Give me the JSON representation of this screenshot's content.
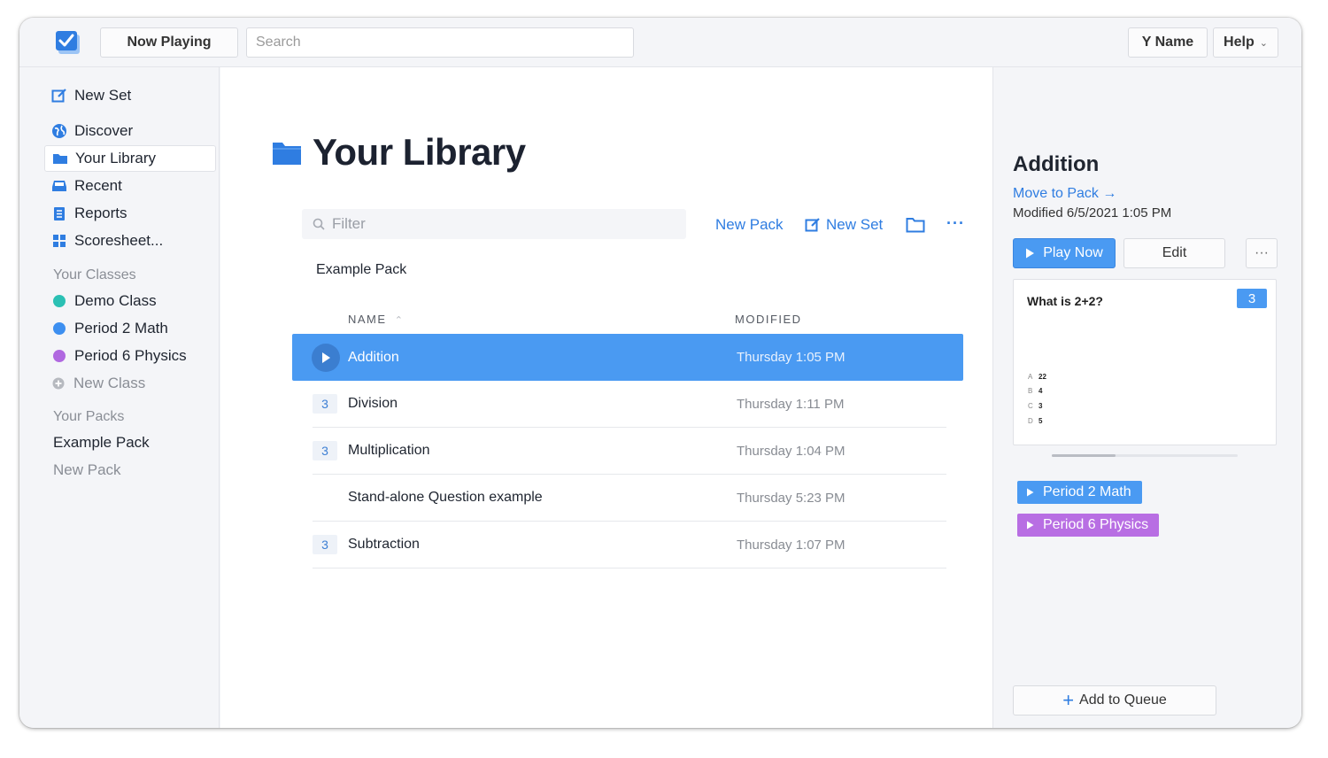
{
  "topbar": {
    "now_playing": "Now Playing",
    "search_placeholder": "Search",
    "user_name": "Y Name",
    "help": "Help"
  },
  "sidebar": {
    "new_set": "New Set",
    "discover": "Discover",
    "your_library": "Your Library",
    "recent": "Recent",
    "reports": "Reports",
    "scoresheet": "Scoresheet...",
    "classes_heading": "Your Classes",
    "classes": [
      {
        "label": "Demo Class",
        "color": "#2bc0b4"
      },
      {
        "label": "Period 2 Math",
        "color": "#3d8ff0"
      },
      {
        "label": "Period 6 Physics",
        "color": "#b068e0"
      }
    ],
    "new_class": "New Class",
    "packs_heading": "Your Packs",
    "packs": [
      "Example Pack"
    ],
    "new_pack": "New Pack"
  },
  "main": {
    "title": "Your Library",
    "filter_placeholder": "Filter",
    "new_pack": "New Pack",
    "new_set": "New Set",
    "crumb": "Example Pack",
    "col_name": "NAME",
    "col_modified": "MODIFIED",
    "rows": [
      {
        "count": "",
        "name": "Addition",
        "modified": "Thursday 1:05 PM"
      },
      {
        "count": "3",
        "name": "Division",
        "modified": "Thursday 1:11 PM"
      },
      {
        "count": "3",
        "name": "Multiplication",
        "modified": "Thursday 1:04 PM"
      },
      {
        "count": "",
        "name": "Stand-alone Question example",
        "modified": "Thursday 5:23 PM"
      },
      {
        "count": "3",
        "name": "Subtraction",
        "modified": "Thursday 1:07 PM"
      }
    ]
  },
  "detail": {
    "title": "Addition",
    "move_to_pack": "Move to Pack",
    "modified": "Modified 6/5/2021 1:05 PM",
    "play_now": "Play Now",
    "edit": "Edit",
    "question": "What is 2+2?",
    "question_count": "3",
    "answers": [
      {
        "letter": "A",
        "value": "22"
      },
      {
        "letter": "B",
        "value": "4"
      },
      {
        "letter": "C",
        "value": "3"
      },
      {
        "letter": "D",
        "value": "5"
      }
    ],
    "classes": [
      {
        "label": "Period 2 Math",
        "color": "#4a9af2"
      },
      {
        "label": "Period 6 Physics",
        "color": "#b86ee3"
      }
    ],
    "add_to_queue": "Add to Queue"
  }
}
